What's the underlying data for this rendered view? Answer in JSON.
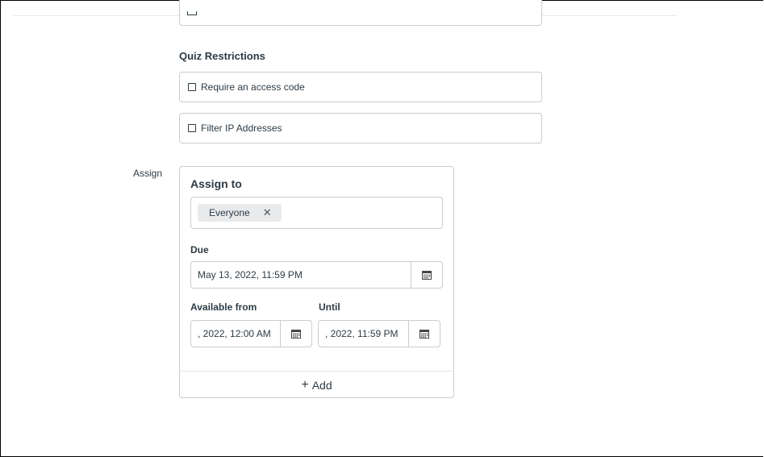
{
  "quiz_restrictions": {
    "title": "Quiz Restrictions",
    "options": [
      {
        "label": "Require an access code",
        "checked": false
      },
      {
        "label": "Filter IP Addresses",
        "checked": false
      }
    ]
  },
  "assign": {
    "row_label": "Assign",
    "assign_to_title": "Assign to",
    "tokens": [
      {
        "label": "Everyone",
        "remove_glyph": "✕"
      }
    ],
    "due_label": "Due",
    "due_value": "May 13, 2022, 11:59 PM",
    "available_from_label": "Available from",
    "available_from_value": ", 2022, 12:00 AM",
    "until_label": "Until",
    "until_value": ", 2022, 11:59 PM",
    "add_label": "Add",
    "add_glyph": "+"
  },
  "icons": {
    "calendar": "calendar-icon",
    "remove": "close-icon",
    "add": "plus-icon"
  }
}
